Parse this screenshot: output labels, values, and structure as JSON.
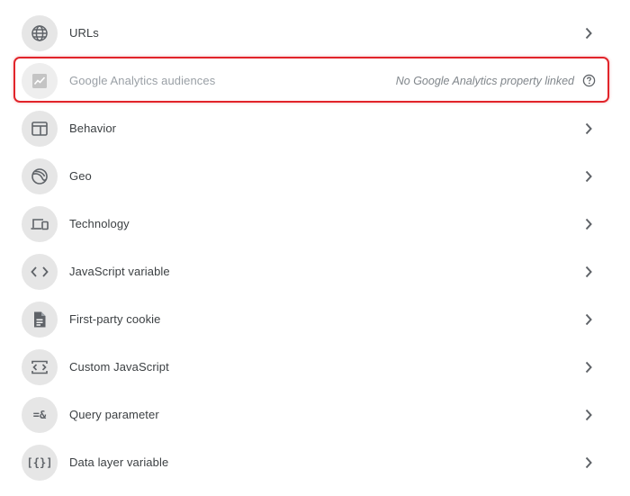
{
  "items": [
    {
      "label": "URLs",
      "icon": "globe-icon"
    },
    {
      "label": "Google Analytics audiences",
      "icon": "analytics-chart-icon",
      "disabled": true,
      "note": "No Google Analytics property linked"
    },
    {
      "label": "Behavior",
      "icon": "browser-window-icon"
    },
    {
      "label": "Geo",
      "icon": "earth-icon"
    },
    {
      "label": "Technology",
      "icon": "devices-icon"
    },
    {
      "label": "JavaScript variable",
      "icon": "code-brackets-icon"
    },
    {
      "label": "First-party cookie",
      "icon": "document-icon"
    },
    {
      "label": "Custom JavaScript",
      "icon": "code-frame-icon"
    },
    {
      "label": "Query parameter",
      "icon": "query-parameter-icon",
      "glyph": "=&"
    },
    {
      "label": "Data layer variable",
      "icon": "data-layer-icon",
      "glyph": "[{}]"
    }
  ],
  "colors": {
    "highlight": "#e1242a",
    "icon_bg": "#e6e6e6",
    "text": "#3c4043",
    "disabled_text": "#9aa0a6"
  }
}
